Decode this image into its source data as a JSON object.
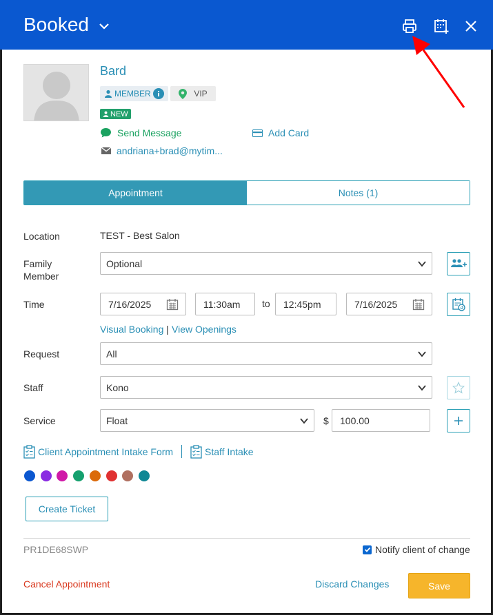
{
  "header": {
    "title": "Booked",
    "bg_color": "#0a58d0",
    "icons": [
      "chevron-down-icon",
      "print-icon",
      "calendar-add-icon",
      "close-icon"
    ]
  },
  "client": {
    "name": "Bard",
    "badges": {
      "member": "MEMBER",
      "vip": "VIP",
      "new": "NEW"
    },
    "send_message": "Send Message",
    "add_card": "Add Card",
    "email": "andriana+brad@mytim..."
  },
  "tabs": [
    {
      "label": "Appointment",
      "active": true
    },
    {
      "label": "Notes (1)",
      "active": false
    }
  ],
  "form": {
    "location_label": "Location",
    "location_value": "TEST - Best Salon",
    "family_label_1": "Family",
    "family_label_2": "Member",
    "family_value": "Optional",
    "time_label": "Time",
    "start_date": "7/16/2025",
    "start_time": "11:30am",
    "to_text": "to",
    "end_time": "12:45pm",
    "end_date": "7/16/2025",
    "visual_booking": "Visual Booking",
    "separator": "|",
    "view_openings": "View Openings",
    "request_label": "Request",
    "request_value": "All",
    "staff_label": "Staff",
    "staff_value": "Kono",
    "service_label": "Service",
    "service_value": "Float",
    "currency": "$",
    "price": "100.00",
    "intake_form": "Client Appointment Intake Form",
    "staff_intake": "Staff Intake"
  },
  "colors": [
    "#0b57d0",
    "#8a2be2",
    "#d019a8",
    "#15a06e",
    "#db6a0a",
    "#e03131",
    "#b07060",
    "#0f8795"
  ],
  "actions": {
    "create_ticket": "Create Ticket",
    "code": "PR1DE68SWP",
    "notify": "Notify client of change",
    "notify_checked": true,
    "cancel": "Cancel Appointment",
    "discard": "Discard Changes",
    "save": "Save"
  }
}
